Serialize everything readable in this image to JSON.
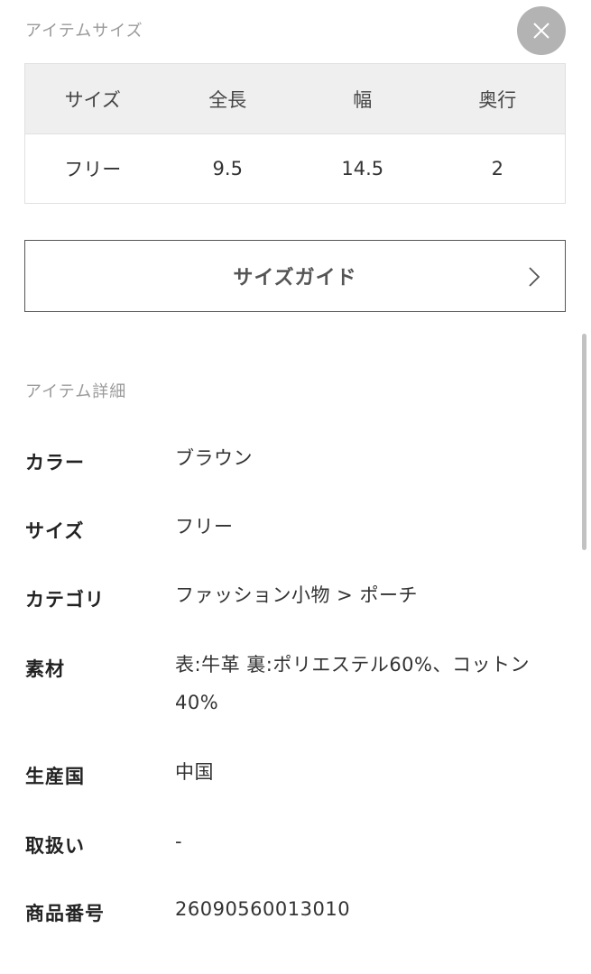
{
  "size_section": {
    "title": "アイテムサイズ",
    "table": {
      "headers": [
        "サイズ",
        "全長",
        "幅",
        "奥行"
      ],
      "rows": [
        [
          "フリー",
          "9.5",
          "14.5",
          "2"
        ]
      ]
    },
    "size_guide_label": "サイズガイド"
  },
  "close_icon": "close-icon",
  "detail_section": {
    "title": "アイテム詳細",
    "items": [
      {
        "label": "カラー",
        "value": "ブラウン"
      },
      {
        "label": "サイズ",
        "value": "フリー"
      },
      {
        "label": "カテゴリ",
        "value": "ファッション小物 > ポーチ"
      },
      {
        "label": "素材",
        "value": "表:牛革 裏:ポリエステル60%、コットン40%"
      },
      {
        "label": "生産国",
        "value": "中国"
      },
      {
        "label": "取扱い",
        "value": "-"
      },
      {
        "label": "商品番号",
        "value": "26090560013010"
      }
    ]
  },
  "colors": {
    "close_button_bg": "#b3b3b3",
    "table_header_bg": "#efefef",
    "border": "#e0e0e0",
    "muted_text": "#9a9a9a"
  }
}
